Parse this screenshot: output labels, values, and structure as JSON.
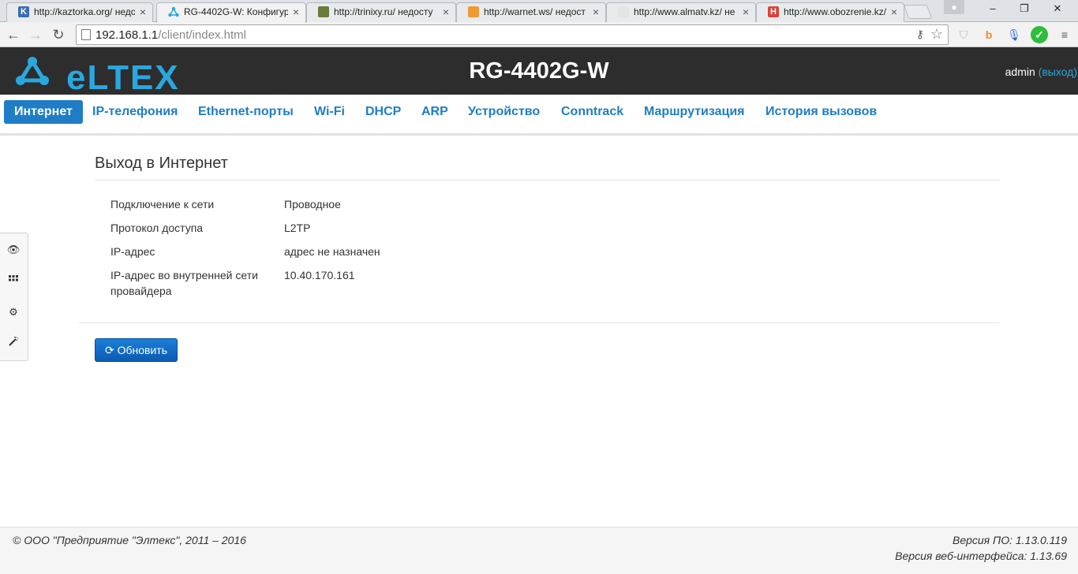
{
  "browser": {
    "tabs": [
      {
        "title": "http://kaztorka.org/ недос",
        "favicon_color": "#3b6cb4",
        "favicon": "K"
      },
      {
        "title": "RG-4402G-W: Конфигура",
        "favicon_color": "#29a8df",
        "favicon": "eltex-icon"
      },
      {
        "title": "http://trinixy.ru/ недосту",
        "favicon_color": "#6a7a3a",
        "favicon": "T"
      },
      {
        "title": "http://warnet.ws/ недост",
        "favicon_color": "#f09a36",
        "favicon": "W"
      },
      {
        "title": "http://www.almatv.kz/ не",
        "favicon_color": "#dddddd",
        "favicon": ""
      },
      {
        "title": "http://www.obozrenie.kz/",
        "favicon_color": "#d9443a",
        "favicon": "H"
      }
    ],
    "active_tab": 1,
    "window_controls": {
      "minimize": "–",
      "restore": "❐",
      "close": "✕"
    },
    "url_host": "192.168.1.1",
    "url_path": "/client/index.html"
  },
  "header": {
    "logo_text": "eLTEX",
    "device": "RG-4402G-W",
    "user": "admin",
    "logout": "(выход)"
  },
  "menu": [
    "Интернет",
    "IP-телефония",
    "Ethernet-порты",
    "Wi-Fi",
    "DHCP",
    "ARP",
    "Устройство",
    "Conntrack",
    "Маршрутизация",
    "История вызовов"
  ],
  "side_toolbar": [
    "eye-icon",
    "grid-icon",
    "gear-icon",
    "wand-icon"
  ],
  "section": {
    "title": "Выход в Интернет",
    "rows": [
      {
        "label": "Подключение к сети",
        "value": "Проводное"
      },
      {
        "label": "Протокол доступа",
        "value": "L2TP"
      },
      {
        "label": "IP-адрес",
        "value": "адрес не назначен"
      },
      {
        "label": "IP-адрес во внутренней сети провайдера",
        "value": "10.40.170.161"
      }
    ],
    "refresh_button": "Обновить"
  },
  "footer": {
    "copyright": "© ООО \"Предприятие \"Элтекс\", 2011 – 2016",
    "fw_version": "Версия ПО: 1.13.0.119",
    "web_version": "Версия веб-интерфейса: 1.13.69"
  },
  "colors": {
    "accent": "#1f7dc6",
    "header_bg": "#2d2d2d",
    "logo": "#29a8df"
  }
}
